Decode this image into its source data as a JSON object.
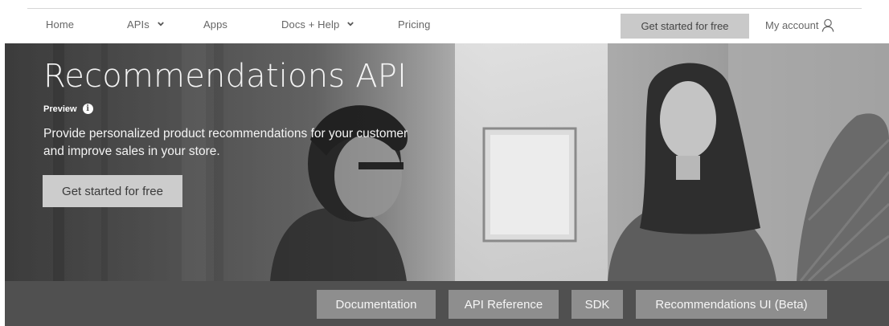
{
  "nav": {
    "items": [
      {
        "label": "Home",
        "has_dropdown": false
      },
      {
        "label": "APIs",
        "has_dropdown": true
      },
      {
        "label": "Apps",
        "has_dropdown": false
      },
      {
        "label": "Docs + Help",
        "has_dropdown": true
      },
      {
        "label": "Pricing",
        "has_dropdown": false
      }
    ],
    "cta_label": "Get started for free",
    "account_label": "My account",
    "account_icon": "user-icon",
    "dropdown_icon": "chevron-down-icon"
  },
  "hero": {
    "title": "Recommendations API",
    "badge": "Preview",
    "info_icon": "info-icon",
    "description": "Provide personalized product recommendations for your customer and improve sales in your store.",
    "cta_label": "Get started for free"
  },
  "links": [
    {
      "label": "Documentation"
    },
    {
      "label": "API Reference"
    },
    {
      "label": "SDK"
    },
    {
      "label": "Recommendations UI (Beta)"
    }
  ],
  "colors": {
    "nav_cta_bg": "#c9c9c9",
    "hero_cta_bg": "#cccccc",
    "link_bar_bg": "#505050",
    "link_button_bg": "#8e8e8e"
  }
}
